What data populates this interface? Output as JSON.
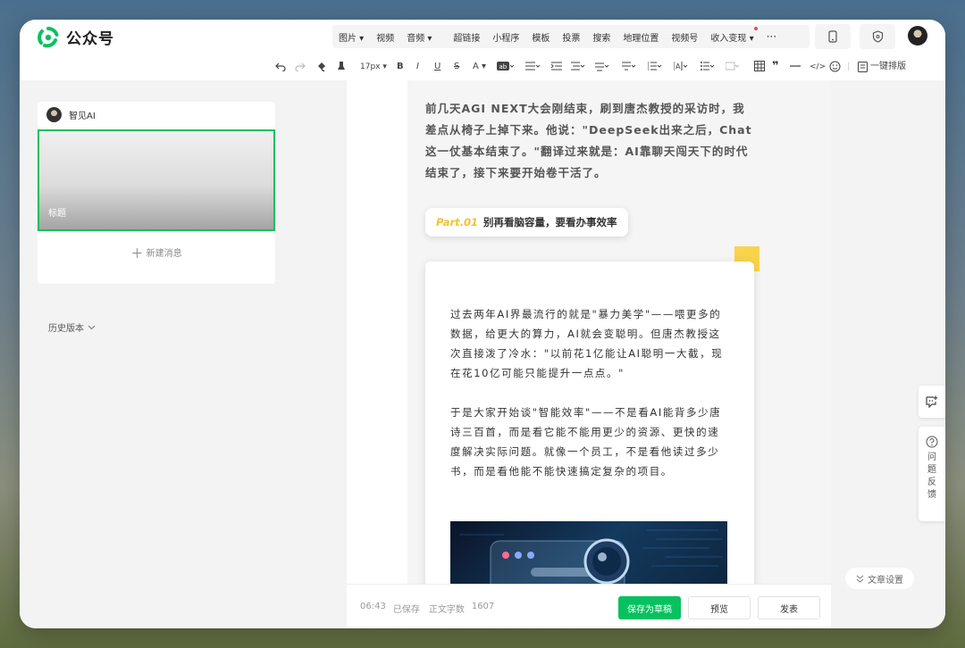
{
  "app": {
    "name": "公众号",
    "brand_color": "#07c160"
  },
  "insert_bar": {
    "items": [
      {
        "label": "图片",
        "dropdown": true
      },
      {
        "label": "视频",
        "dropdown": false
      },
      {
        "label": "音频",
        "dropdown": true
      },
      {
        "label": "超链接",
        "dropdown": false
      },
      {
        "label": "小程序",
        "dropdown": false
      },
      {
        "label": "模板",
        "dropdown": false
      },
      {
        "label": "投票",
        "dropdown": false
      },
      {
        "label": "搜索",
        "dropdown": false
      },
      {
        "label": "地理位置",
        "dropdown": false
      },
      {
        "label": "视频号",
        "dropdown": false
      },
      {
        "label": "收入变现",
        "dropdown": true,
        "badge": true
      }
    ],
    "more": "···"
  },
  "toolbar": {
    "font_size": "17px",
    "layout_label": "一键排版"
  },
  "sidebar": {
    "account_name": "智见AI",
    "cover_title": "标题",
    "new_message": "新建消息",
    "history": "历史版本"
  },
  "article": {
    "intro": "前几天AGI NEXT大会刚结束，刷到唐杰教授的采访时，我差点从椅子上掉下来。他说：\"DeepSeek出来之后，Chat这一仗基本结束了。\"翻译过来就是：AI靠聊天闯天下的时代结束了，接下来要开始卷干活了。",
    "part_number": "Part.01",
    "part_title": "别再看脑容量，要看办事效率",
    "paragraph_1": "过去两年AI界最流行的就是\"暴力美学\"——喂更多的数据，给更大的算力，AI就会变聪明。但唐杰教授这次直接泼了冷水：\"以前花1亿能让AI聪明一大截，现在花10亿可能只能提升一点点。\"",
    "paragraph_2": "于是大家开始谈\"智能效率\"——不是看AI能背多少唐诗三百首，而是看它能不能用更少的资源、更快的速度解决实际问题。就像一个员工，不是看他读过多少书，而是看他能不能快速搞定复杂的项目。"
  },
  "bottom_bar": {
    "time": "06:43",
    "saved": "已保存",
    "word_count_label": "正文字数",
    "word_count": "1607",
    "save_draft": "保存为草稿",
    "preview": "预览",
    "publish": "发表"
  },
  "right_panel": {
    "feedback": "问题反馈",
    "article_settings": "文章设置"
  }
}
